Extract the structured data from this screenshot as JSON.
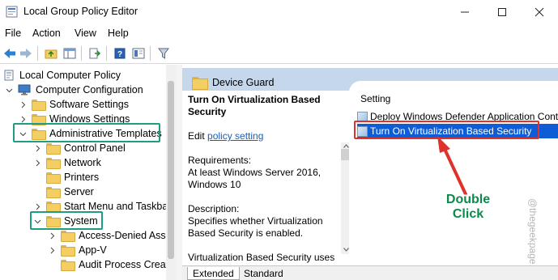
{
  "window": {
    "title": "Local Group Policy Editor"
  },
  "menu": [
    "File",
    "Action",
    "View",
    "Help"
  ],
  "tree": {
    "root": "Local Computer Policy",
    "computer_config": "Computer Configuration",
    "software_settings": "Software Settings",
    "windows_settings": "Windows Settings",
    "admin_templates": "Administrative Templates",
    "control_panel": "Control Panel",
    "network": "Network",
    "printers": "Printers",
    "server": "Server",
    "start_menu": "Start Menu and Taskbar",
    "system": "System",
    "access_denied": "Access-Denied Assis",
    "app_v": "App-V",
    "audit_process": "Audit Process Creati"
  },
  "panel": {
    "header": "Device Guard",
    "policy_title": "Turn On Virtualization Based Security",
    "edit_prefix": "Edit ",
    "edit_link": "policy setting",
    "requirements_label": "Requirements:",
    "requirements_text": "At least Windows Server 2016, Windows 10",
    "description_label": "Description:",
    "description_text": "Specifies whether Virtualization Based Security is enabled.",
    "description_more": "Virtualization Based Security uses"
  },
  "list": {
    "column_header": "Setting",
    "items": [
      "Deploy Windows Defender Application Control",
      "Turn On Virtualization Based Security"
    ]
  },
  "annotation": {
    "line1": "Double",
    "line2": "Click",
    "color": "#0b8a4a",
    "box_green": "#1f9c83",
    "box_red": "#e0322d"
  },
  "watermark": "@thegeekpage.com",
  "tabs": {
    "extended": "Extended",
    "standard": "Standard"
  }
}
